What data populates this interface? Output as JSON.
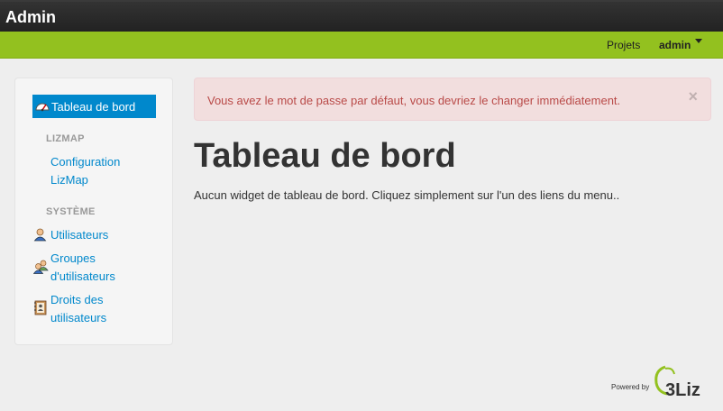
{
  "header": {
    "brand": "Admin"
  },
  "topnav": {
    "projets": "Projets",
    "user": "admin"
  },
  "sidebar": {
    "active": {
      "label": "Tableau de bord",
      "icon": "dashboard-icon"
    },
    "sections": [
      {
        "title": "LIZMAP",
        "items": [
          {
            "line1": "Configuration",
            "line2": "LizMap"
          }
        ]
      },
      {
        "title": "SYSTÈME",
        "items": [
          {
            "line1": "Utilisateurs",
            "icon": "user-icon"
          },
          {
            "line1": "Groupes",
            "line2": "d'utilisateurs",
            "icon": "group-icon"
          },
          {
            "line1": "Droits des",
            "line2": "utilisateurs",
            "icon": "rights-book-icon"
          }
        ]
      }
    ]
  },
  "alert": {
    "message": "Vous avez le mot de passe par défaut, vous devriez le changer immédiatement.",
    "close": "×"
  },
  "main": {
    "title": "Tableau de bord",
    "text": "Aucun widget de tableau de bord. Cliquez simplement sur l'un des liens du menu.."
  },
  "footer": {
    "powered": "Powered by",
    "logo_text": "3Liz"
  },
  "colors": {
    "accent": "#0088cc",
    "green_bar": "#93c11f",
    "alert_bg": "#f2dede",
    "alert_text": "#b94a48"
  }
}
